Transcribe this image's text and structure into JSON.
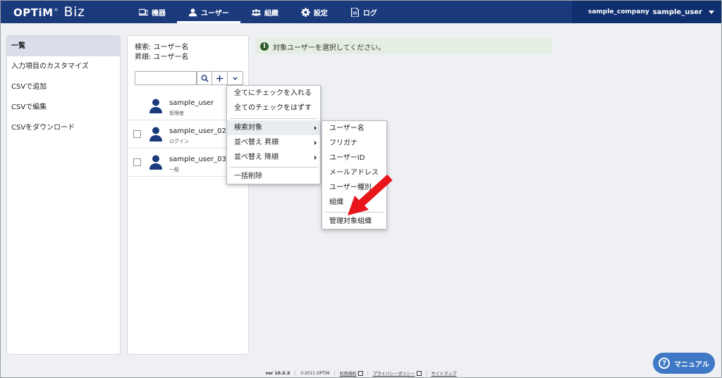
{
  "header": {
    "logo_main": "OPTiM",
    "logo_reg": "®",
    "logo_sub": "Biz",
    "nav": [
      {
        "label": "機器",
        "icon": "device-icon"
      },
      {
        "label": "ユーザー",
        "icon": "user-icon",
        "active": true
      },
      {
        "label": "組織",
        "icon": "organization-icon"
      },
      {
        "label": "設定",
        "icon": "gear-icon"
      },
      {
        "label": "ログ",
        "icon": "document-icon"
      }
    ],
    "company": "sample_company",
    "user": "sample_user"
  },
  "sidebar": {
    "items": [
      {
        "label": "一覧",
        "active": true
      },
      {
        "label": "入力項目のカスタマイズ"
      },
      {
        "label": "CSVで追加"
      },
      {
        "label": "CSVで編集"
      },
      {
        "label": "CSVをダウンロード"
      }
    ]
  },
  "user_panel": {
    "search_target": "検索: ユーザー名",
    "sort_order": "昇順: ユーザー名",
    "search_placeholder": "",
    "users": [
      {
        "name": "sample_user",
        "role": "管理者",
        "checkbox": false
      },
      {
        "name": "sample_user_02",
        "role": "ログイン",
        "checkbox": true
      },
      {
        "name": "sample_user_03",
        "role": "一般",
        "checkbox": true
      }
    ]
  },
  "banner": {
    "icon": "i",
    "message": "対象ユーザーを選択してください。"
  },
  "menu": {
    "check_all": "全てにチェックを入れる",
    "uncheck_all": "全てのチェックをはずす",
    "search_target": "検索対象",
    "sort_asc": "並べ替え 昇順",
    "sort_desc": "並べ替え 降順",
    "bulk_delete": "一括削除"
  },
  "submenu": {
    "items": [
      "ユーザー名",
      "フリガナ",
      "ユーザーID",
      "メールアドレス",
      "ユーザー種別",
      "組織"
    ],
    "managed_org": "管理対象組織"
  },
  "footer": {
    "version": "ver 10.X.X",
    "copyright": "©2011 OPTiM",
    "terms": "利用規約",
    "privacy": "プライバシーポリシー",
    "sitemap": "サイトマップ"
  },
  "manual_button": {
    "label": "マニュアル",
    "icon": "?"
  },
  "colors": {
    "header_bg": "#1a3a7c",
    "account_bg": "#0f2f6e",
    "banner_bg": "#e4eee2",
    "manual_bg": "#3f78c4",
    "arrow": "#e8161b"
  }
}
